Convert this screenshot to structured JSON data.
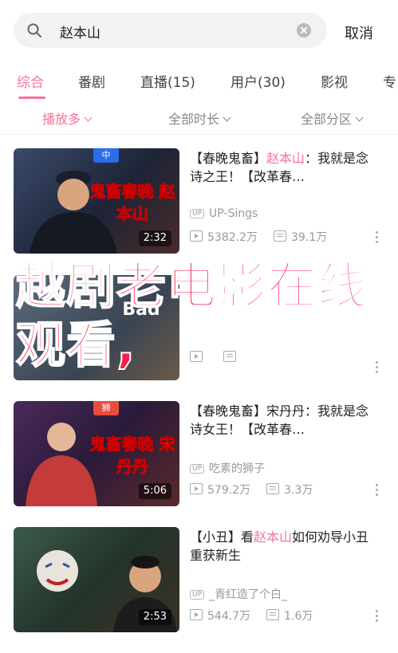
{
  "search": {
    "query": "赵本山",
    "cancel_label": "取消"
  },
  "tabs": [
    "综合",
    "番剧",
    "直播(15)",
    "用户(30)",
    "影视",
    "专"
  ],
  "filters": [
    "播放多",
    "全部时长",
    "全部分区"
  ],
  "videos": [
    {
      "title_prefix": "【春晚鬼畜】",
      "title_highlight": "赵本山",
      "title_suffix": "：我就是念诗之王！【改革春…",
      "uploader": "UP-Sings",
      "views": "5382.2万",
      "danmaku": "39.1万",
      "duration": "2:32",
      "thumb_caption": "鬼畜春晚 赵本山",
      "thumb_badge": "中"
    },
    {
      "title_prefix": "",
      "title_highlight": "",
      "title_suffix": "",
      "uploader": "",
      "views": "",
      "danmaku": "",
      "duration": "",
      "thumb_caption": "Bad",
      "thumb_badge": ""
    },
    {
      "title_prefix": "【春晚鬼畜】",
      "title_highlight": "",
      "title_suffix": "宋丹丹：我就是念诗女王！【改革春…",
      "uploader": "吃素的狮子",
      "views": "579.2万",
      "danmaku": "3.3万",
      "duration": "5:06",
      "thumb_caption": "鬼畜春晚 宋丹丹",
      "thumb_badge": "狮"
    },
    {
      "title_prefix": "【小丑】看",
      "title_highlight": "赵本山",
      "title_suffix": "如何劝导小丑重获新生",
      "uploader": "_青红造了个白_",
      "views": "544.7万",
      "danmaku": "1.6万",
      "duration": "2:53",
      "thumb_caption": "",
      "thumb_badge": ""
    }
  ],
  "overlay_text": "越剧老电影在线观看,",
  "colors": {
    "accent": "#fb7299",
    "overlay": "#ff1a4b"
  }
}
